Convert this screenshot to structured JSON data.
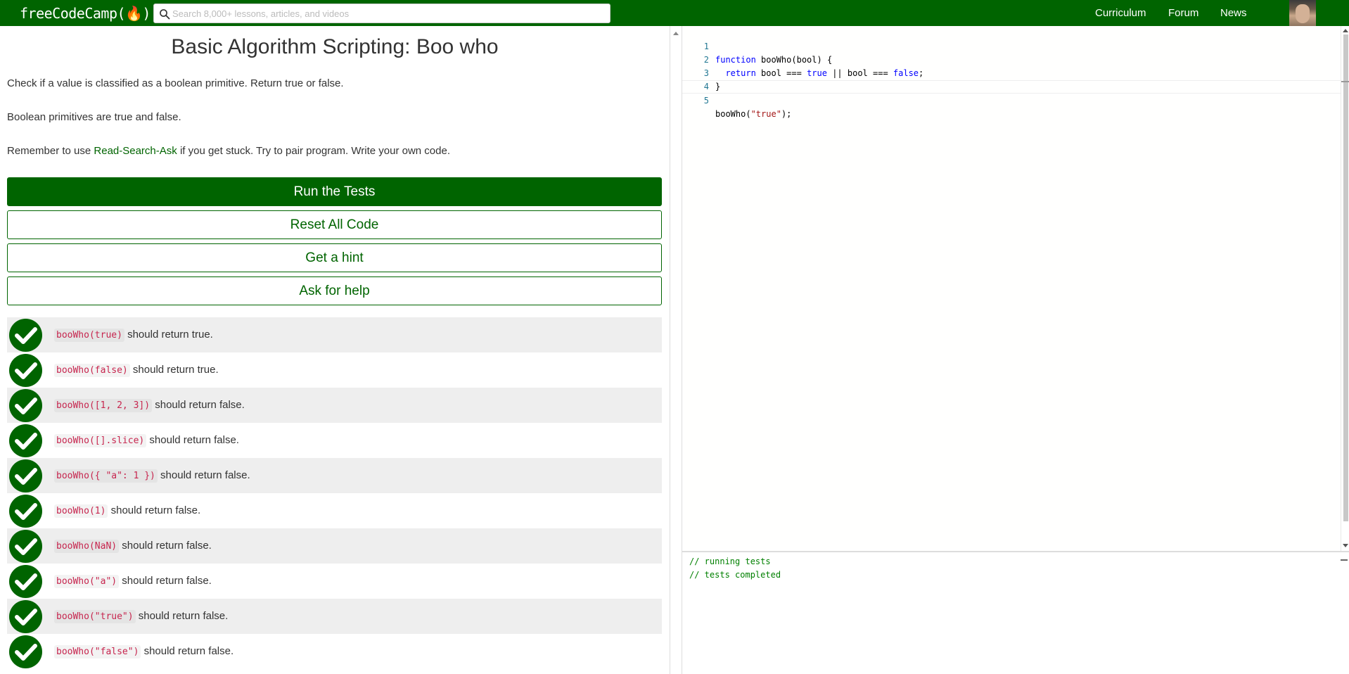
{
  "navbar": {
    "brand": "freeCodeCamp(🔥)",
    "search_placeholder": "Search 8,000+ lessons, articles, and videos",
    "links": [
      "Curriculum",
      "Forum",
      "News"
    ]
  },
  "challenge": {
    "title": "Basic Algorithm Scripting: Boo who",
    "desc1": "Check if a value is classified as a boolean primitive. Return true or false.",
    "desc2": "Boolean primitives are true and false.",
    "desc3_before": "Remember to use ",
    "desc3_link": "Read-Search-Ask",
    "desc3_after": " if you get stuck. Try to pair program. Write your own code."
  },
  "buttons": {
    "run": "Run the Tests",
    "reset": "Reset All Code",
    "hint": "Get a hint",
    "help": "Ask for help"
  },
  "tests": [
    {
      "code": "booWho(true)",
      "text": " should return true."
    },
    {
      "code": "booWho(false)",
      "text": " should return true."
    },
    {
      "code": "booWho([1, 2, 3])",
      "text": " should return false."
    },
    {
      "code": "booWho([].slice)",
      "text": " should return false."
    },
    {
      "code": "booWho({ \"a\": 1 })",
      "text": " should return false."
    },
    {
      "code": "booWho(1)",
      "text": " should return false."
    },
    {
      "code": "booWho(NaN)",
      "text": " should return false."
    },
    {
      "code": "booWho(\"a\")",
      "text": " should return false."
    },
    {
      "code": "booWho(\"true\")",
      "text": " should return false."
    },
    {
      "code": "booWho(\"false\")",
      "text": " should return false."
    }
  ],
  "editor": {
    "line_numbers": [
      "1",
      "2",
      "3",
      "4",
      "5"
    ],
    "l1_kw": "function",
    "l1_rest": " booWho(bool) {",
    "l2_indent": "  ",
    "l2_kw": "return",
    "l2_a": " bool === ",
    "l2_true": "true",
    "l2_b": " || bool === ",
    "l2_false": "false",
    "l2_c": ";",
    "l3": "}",
    "l5_a": "booWho(",
    "l5_str": "\"true\"",
    "l5_b": ");"
  },
  "output": {
    "lines": [
      "// running tests",
      "// tests completed"
    ]
  },
  "colors": {
    "brand_green": "#006400",
    "test_code": "#c7254e",
    "keyword": "#0000ff",
    "string": "#a31515",
    "output_text": "#008000"
  }
}
